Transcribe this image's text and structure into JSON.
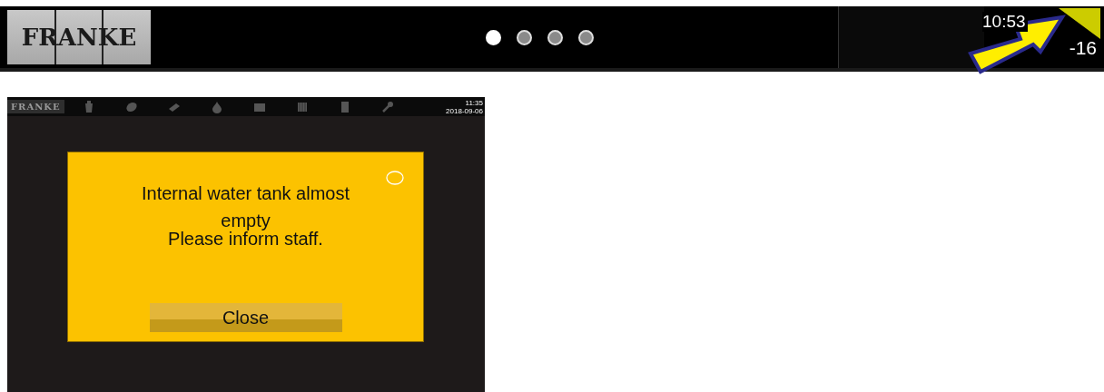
{
  "top_bar": {
    "logo": "FRANKE",
    "pages": [
      {
        "selected": true
      },
      {
        "selected": false
      },
      {
        "selected": false
      },
      {
        "selected": false
      }
    ],
    "time": "10:53",
    "date": "-16"
  },
  "machine_screen": {
    "header": {
      "logo": "FRANKE",
      "time": "11:35",
      "date": "2018-09-06",
      "icons": [
        {
          "kind": "cup"
        },
        {
          "kind": "bean"
        },
        {
          "kind": "grid"
        },
        {
          "kind": "drop"
        },
        {
          "kind": "box"
        },
        {
          "kind": "crate"
        },
        {
          "kind": "book"
        },
        {
          "kind": "wrench"
        }
      ]
    },
    "dialog": {
      "title": "Internal water tank almost empty",
      "message": "Please inform staff.",
      "button": "Close"
    }
  }
}
